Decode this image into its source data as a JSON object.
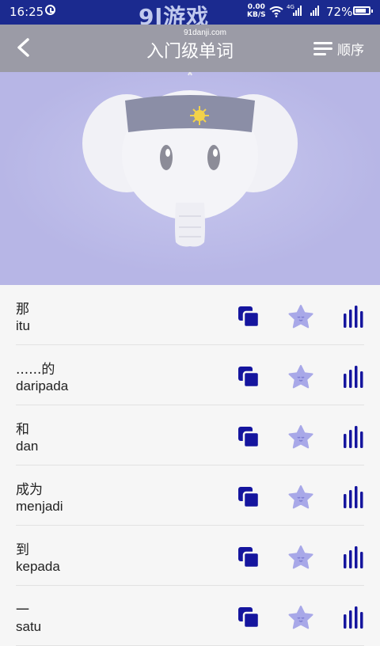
{
  "status": {
    "time": "16:25",
    "net_speed_value": "0.00",
    "net_speed_unit": "KB/S",
    "signal_tag": "4G",
    "battery": "72%",
    "watermark": "9l游戏",
    "watermark_sub": "91danji.com"
  },
  "appbar": {
    "title": "入门级单词",
    "order_label": "顺序"
  },
  "colors": {
    "status_bar": "#1b2a8f",
    "app_bar": "#9b9ba6",
    "hero_bg": "#b7b6e6",
    "icon_navy": "#15159e",
    "star_lavender": "#a8a8e8"
  },
  "words": [
    {
      "zh": "那",
      "ms": "itu"
    },
    {
      "zh": "......的",
      "ms": "daripada"
    },
    {
      "zh": "和",
      "ms": "dan"
    },
    {
      "zh": "成为",
      "ms": "menjadi"
    },
    {
      "zh": "到",
      "ms": "kepada"
    },
    {
      "zh": "一",
      "ms": "satu"
    }
  ]
}
